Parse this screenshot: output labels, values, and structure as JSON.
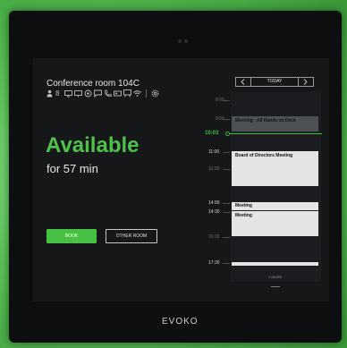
{
  "room": {
    "name": "Conference room 104C",
    "capacity": "8",
    "amenity_icons": [
      "person-icon",
      "monitor-icon",
      "display-icon",
      "camera-icon",
      "chat-icon",
      "phone-icon",
      "projector-icon",
      "whiteboard-icon",
      "wifi-icon",
      "settings-icon"
    ]
  },
  "status": {
    "label": "Available",
    "duration": "for 57 min",
    "color": "#4fc14a"
  },
  "actions": {
    "book_label": "BOOK",
    "other_room_label": "OTHER ROOM"
  },
  "calendar": {
    "today_label": "TODAY",
    "now_time": "10:03",
    "time_labels": [
      "8:00",
      "9:00",
      "11:00",
      "12:00",
      "14:00",
      "14:30",
      "16:00",
      "17:30"
    ],
    "events": [
      {
        "title": "Morning - All Hands on Deck",
        "past": true
      },
      {
        "title": "Board of Directors Meeting",
        "past": false
      },
      {
        "title": "Meeting",
        "past": false
      },
      {
        "title": "Meeting",
        "past": false
      }
    ],
    "more_label": "1 MORE"
  },
  "brand": "EVOKO",
  "colors": {
    "accent": "#47c044",
    "background": "#151719"
  }
}
